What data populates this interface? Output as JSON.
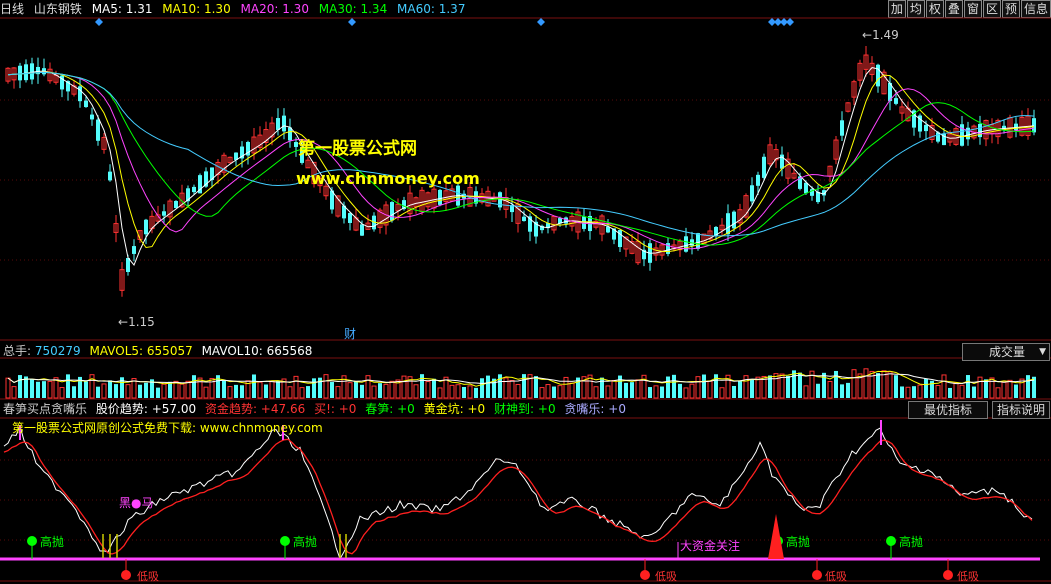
{
  "header": {
    "period": "日线",
    "stock_name": "山东钢铁",
    "ma": [
      {
        "label": "MA5: 1.31",
        "color": "#ffffff"
      },
      {
        "label": "MA10: 1.30",
        "color": "#ffff00"
      },
      {
        "label": "MA20: 1.30",
        "color": "#ff44ff"
      },
      {
        "label": "MA30: 1.34",
        "color": "#00ff00"
      },
      {
        "label": "MA60: 1.37",
        "color": "#44ccff"
      }
    ]
  },
  "toolbar": [
    "加",
    "均",
    "权",
    "叠",
    "窗",
    "区",
    "预",
    "信息"
  ],
  "price_panel": {
    "watermark_cn": "第一股票公式网",
    "watermark_url": "www.chnmoney.com",
    "high_label": "1.49",
    "low_label": "1.15",
    "finance_mark": "财"
  },
  "volume_panel": {
    "values": [
      {
        "label": "总手: ",
        "color": "#cccccc"
      },
      {
        "label": "750279",
        "color": "#44ccff"
      },
      {
        "label": "MAVOL5: 655057",
        "color": "#ffff00"
      },
      {
        "label": "MAVOL10: 665568",
        "color": "#ffffff"
      }
    ],
    "selector": "成交量"
  },
  "indicator_panel": {
    "items": [
      {
        "label": "春笋买点贪嘴乐",
        "color": "#cccccc"
      },
      {
        "label": "股价趋势: +57.00",
        "color": "#ffffff"
      },
      {
        "label": "资金趋势: +47.66",
        "color": "#ff3333"
      },
      {
        "label": "买!: +0",
        "color": "#ff3333"
      },
      {
        "label": "春笋: +0",
        "color": "#00ff00"
      },
      {
        "label": "黄金坑: +0",
        "color": "#ffff00"
      },
      {
        "label": "财神到: +0",
        "color": "#00ff00"
      },
      {
        "label": "贪嘴乐: +0",
        "color": "#aaaaff"
      }
    ],
    "btn_best": "最优指标",
    "btn_help": "指标说明",
    "promo": "第一股票公式网原创公式免费下载: www.chnmoney.com",
    "label_black_horse": "黑",
    "label_horse": "马",
    "label_high": "高抛",
    "label_low": "低吸",
    "label_big_fund": "大资金关注"
  },
  "colors": {
    "up": "#ff3232",
    "down": "#54fcfc",
    "ma5": "#ffffff",
    "ma10": "#ffff00",
    "ma20": "#ff44ff",
    "ma30": "#00ff00",
    "ma60": "#44ccff"
  }
}
